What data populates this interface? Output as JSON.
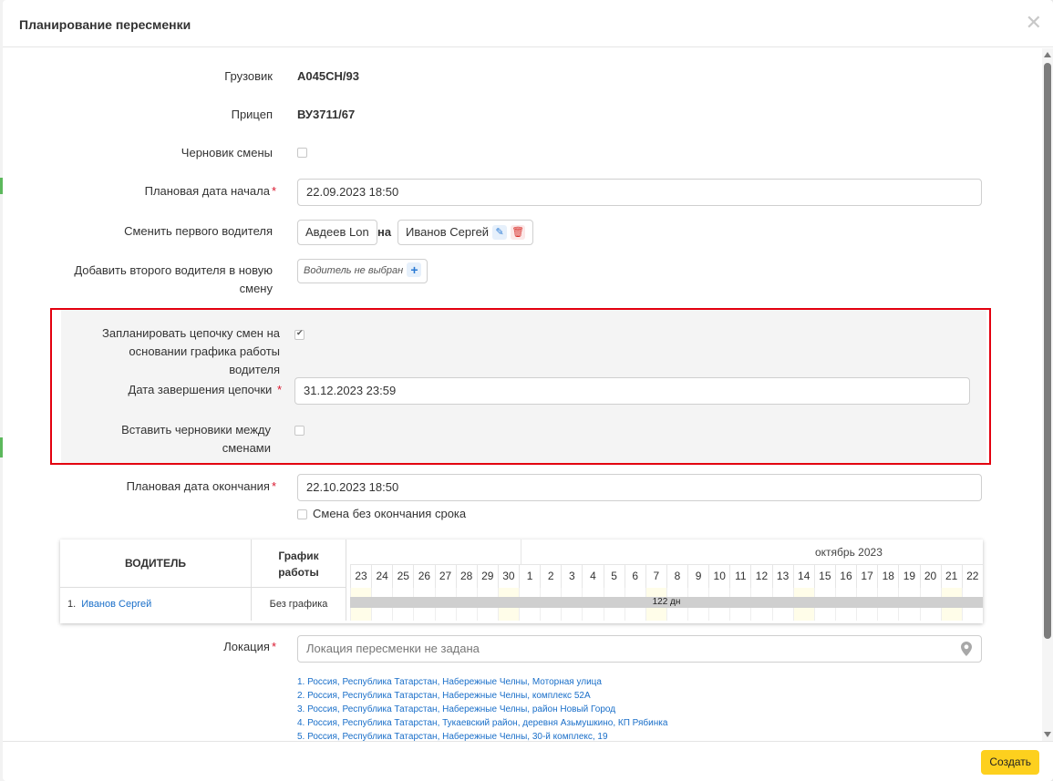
{
  "modal": {
    "title": "Планирование пересменки",
    "close_glyph": "✕",
    "create_label": "Создать"
  },
  "form": {
    "truck": {
      "label": "Грузовик",
      "value": "А045СН/93"
    },
    "trailer": {
      "label": "Прицеп",
      "value": "ВУ3711/67"
    },
    "draft_shift": {
      "label": "Черновик смены",
      "checked": false
    },
    "planned_start": {
      "label": "Плановая дата начала",
      "required": "*",
      "value": "22.09.2023 18:50"
    },
    "change_first_driver": {
      "label": "Сменить первого водителя",
      "from": "Авдеев Lon",
      "connector": "на",
      "to": "Иванов Сергей"
    },
    "add_second_driver": {
      "label_line1": "Добавить второго водителя в новую",
      "label_line2": "смену",
      "placeholder": "Водитель не выбран"
    },
    "chain": {
      "plan_label_line1": "Запланировать цепочку смен на",
      "plan_label_line2": "основании графика работы водителя",
      "plan_checked": true,
      "end_label": "Дата завершения цепочки",
      "end_required": "*",
      "end_value": "31.12.2023 23:59",
      "drafts_label": "Вставить черновики между сменами",
      "drafts_checked": false
    },
    "planned_end": {
      "label": "Плановая дата окончания",
      "required": "*",
      "value": "22.10.2023 18:50",
      "no_end_label": "Смена без окончания срока"
    },
    "location": {
      "label": "Локация",
      "required": "*",
      "placeholder": "Локация пересменки не задана",
      "suggestions": [
        "1. Россия, Республика Татарстан, Набережные Челны, Моторная улица",
        "2. Россия, Республика Татарстан, Набережные Челны, комплекс 52А",
        "3. Россия, Республика Татарстан, Набережные Челны, район Новый Город",
        "4. Россия, Республика Татарстан, Тукаевский район, деревня Азьмушкино, КП Рябинка",
        "5. Россия, Республика Татарстан, Набережные Челны, 30-й комплекс, 19"
      ]
    }
  },
  "schedule": {
    "col_driver": "ВОДИТЕЛЬ",
    "col_schedule_line1": "График",
    "col_schedule_line2": "работы",
    "month": "октябрь 2023",
    "days": [
      "23",
      "24",
      "25",
      "26",
      "27",
      "28",
      "29",
      "30",
      "1",
      "2",
      "3",
      "4",
      "5",
      "6",
      "7",
      "8",
      "9",
      "10",
      "11",
      "12",
      "13",
      "14",
      "15",
      "16",
      "17",
      "18",
      "19",
      "20",
      "21",
      "22"
    ],
    "weekend_days": [
      "23",
      "30",
      "7",
      "14",
      "21"
    ],
    "row": {
      "index": "1.",
      "driver": "Иванов Сергей",
      "schedule": "Без графика",
      "duration": "122 дн"
    }
  },
  "colors": {
    "accent_red": "#e3000f",
    "create_yellow": "#fdd01e",
    "link_blue": "#1a6fc9"
  }
}
